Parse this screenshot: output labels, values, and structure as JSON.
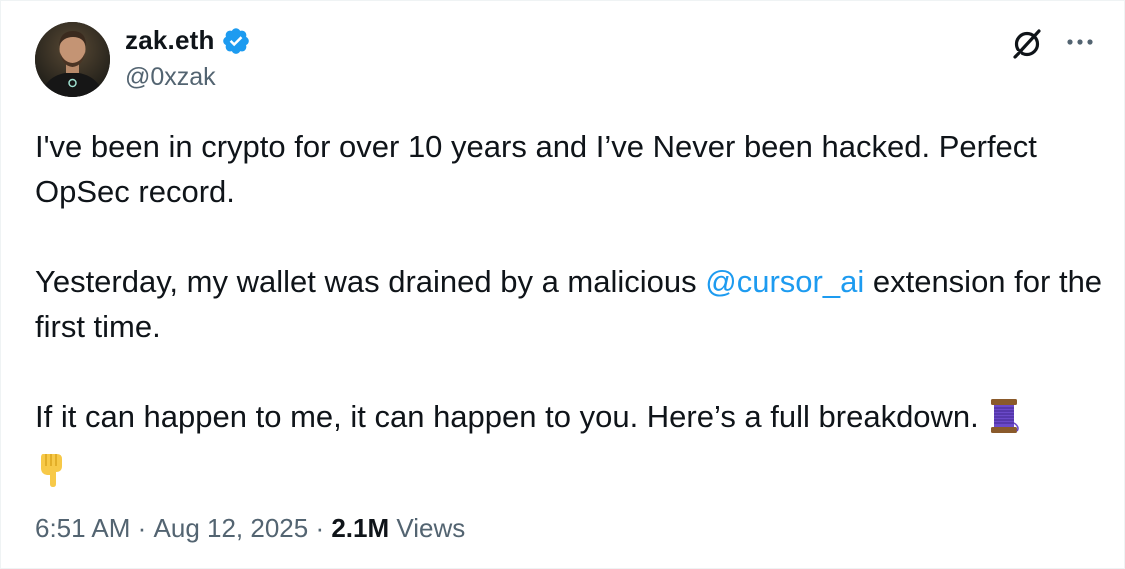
{
  "author": {
    "display_name": "zak.eth",
    "handle": "@0xzak",
    "verified_icon": "verified-badge-icon",
    "verified_color": "#1d9bf0"
  },
  "actions": {
    "grok_icon": "grok-icon",
    "more_icon": "more-options-icon"
  },
  "tweet": {
    "para1": "I've been in crypto for over 10 years and I’ve Never been hacked. Perfect OpSec record.",
    "para2_before": "Yesterday, my wallet was drained by a malicious ",
    "para2_mention": "@cursor_ai",
    "para2_after": " extension for the first time.",
    "para3": "If it can happen to me, it can happen to you. Here’s a full breakdown. ",
    "emoji_1": "thread-spool-emoji",
    "emoji_2": "pointing-down-emoji",
    "mention_color": "#1d9bf0"
  },
  "meta": {
    "time": "6:51 AM",
    "separator": " · ",
    "date": "Aug 12, 2025",
    "views_count": "2.1M",
    "views_label": " Views"
  }
}
